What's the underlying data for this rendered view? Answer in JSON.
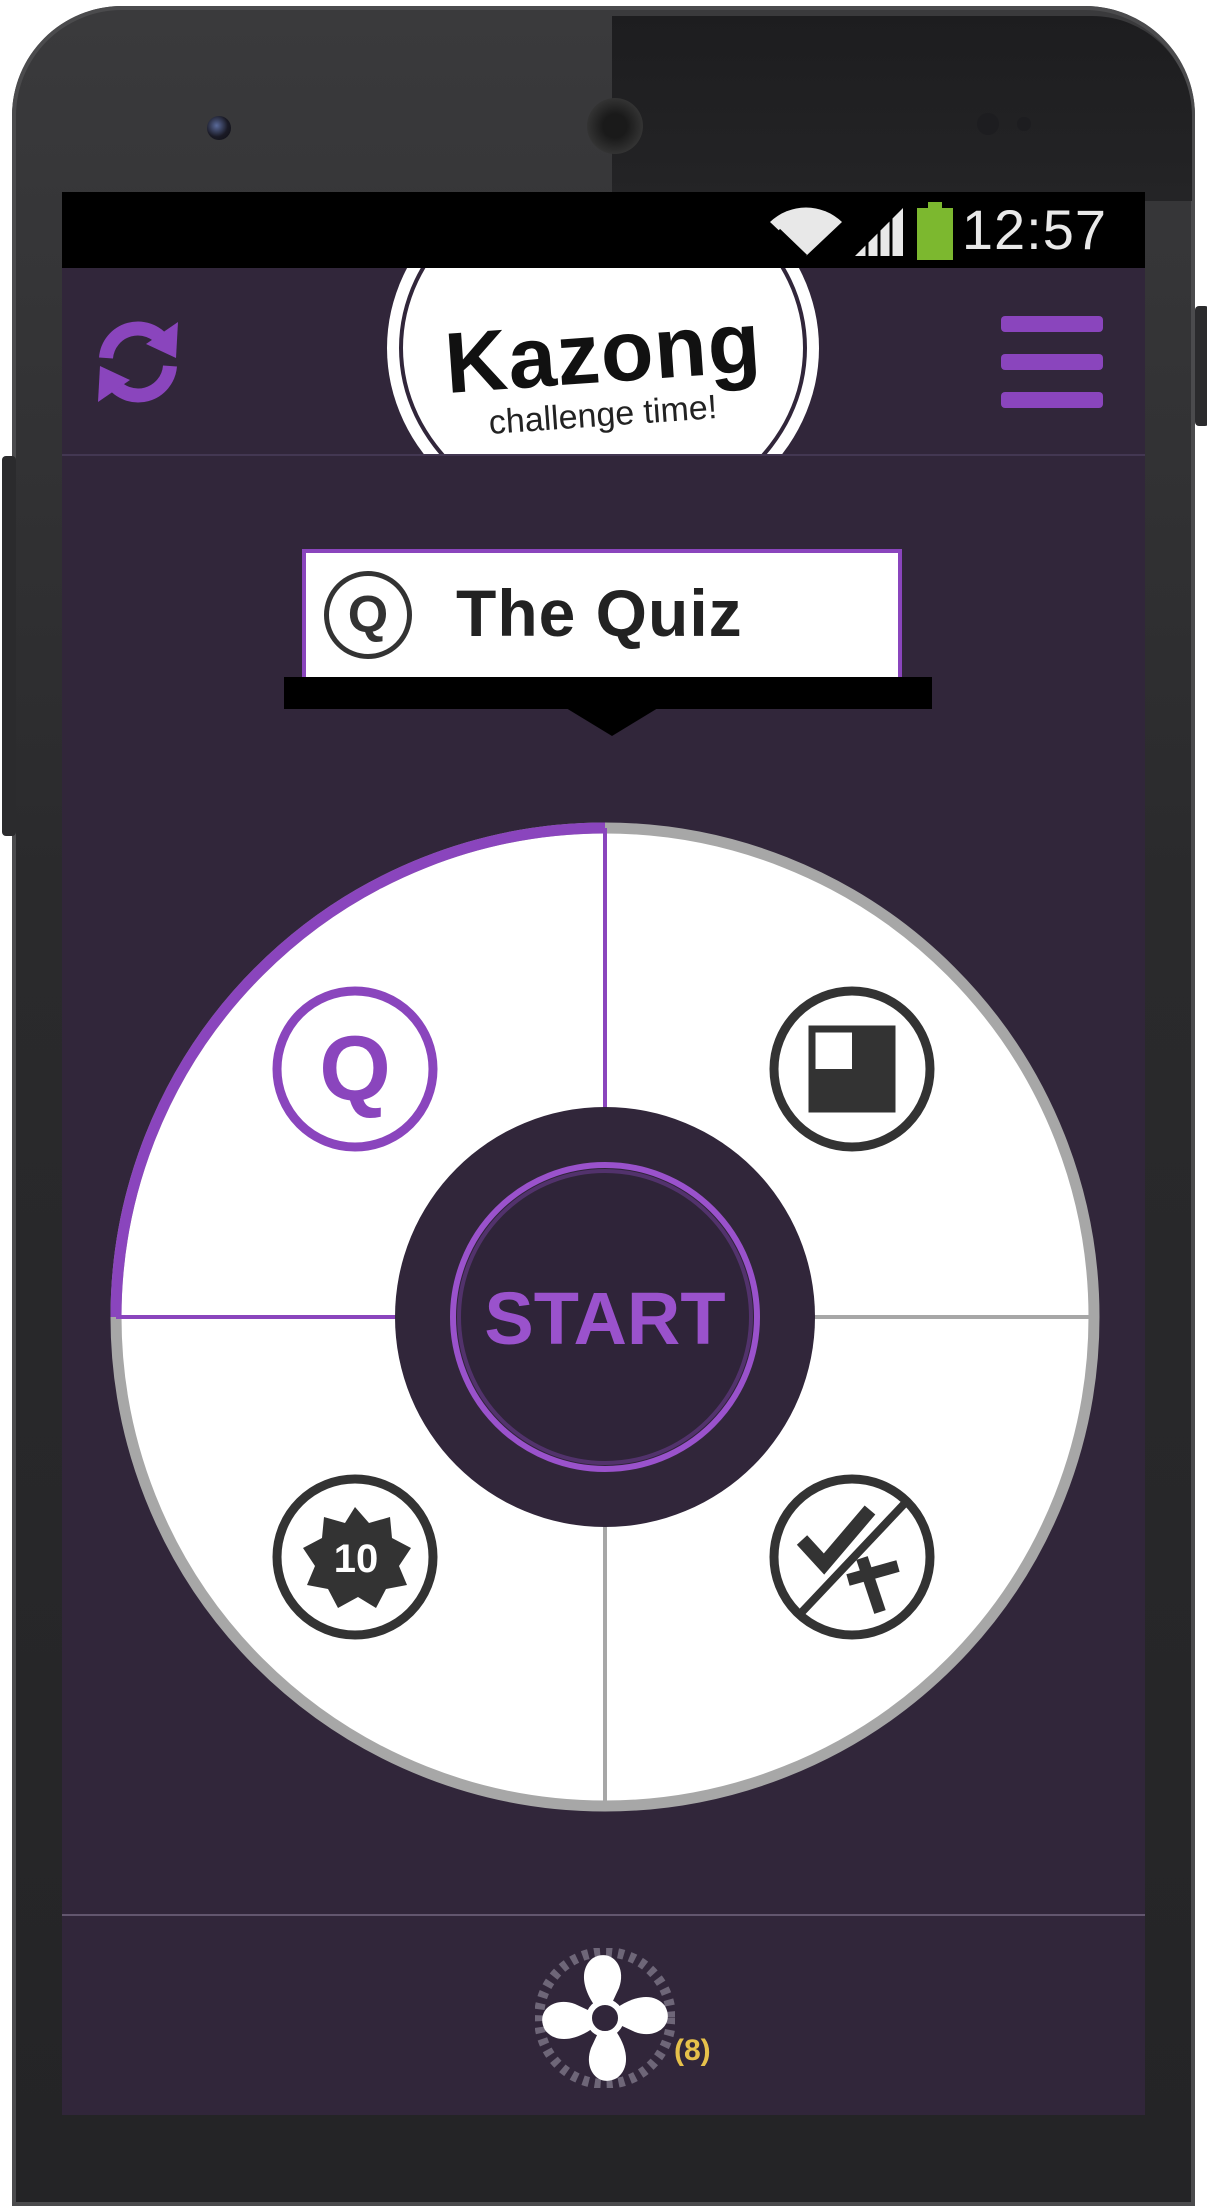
{
  "status_bar": {
    "time": "12:57",
    "icons": [
      "wifi-icon",
      "signal-icon",
      "battery-icon"
    ],
    "battery_color": "#7cb82f"
  },
  "app_bar": {
    "refresh_icon": "refresh-icon",
    "menu_icon": "hamburger-menu-icon",
    "accent_color": "#8a45bd"
  },
  "logo": {
    "title": "Kazong",
    "subtitle": "challenge time!"
  },
  "selected_mode": {
    "icon_letter": "Q",
    "label": "The Quiz"
  },
  "wheel": {
    "start_label": "START",
    "segments": [
      {
        "id": "quiz",
        "icon": "quiz-q-icon",
        "icon_text": "Q",
        "selected": true
      },
      {
        "id": "crossword",
        "icon": "checkerboard-icon",
        "icon_text": "",
        "selected": false
      },
      {
        "id": "top-ten",
        "icon": "badge-10-icon",
        "icon_text": "10",
        "selected": false
      },
      {
        "id": "true-false",
        "icon": "check-cross-icon",
        "icon_text": "",
        "selected": false
      }
    ],
    "colors": {
      "selected": "#8a45bd",
      "unselected": "#a7a7a7",
      "hub": "#31263a"
    }
  },
  "footer": {
    "icon": "fan-icon",
    "count": "(8)",
    "count_color": "#e6c14b"
  }
}
